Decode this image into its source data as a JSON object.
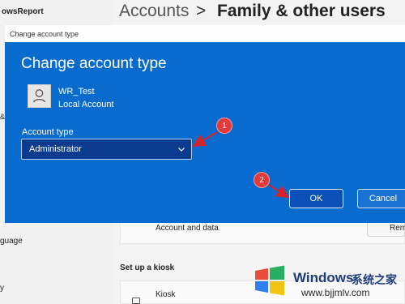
{
  "background": {
    "sidebar_app_name": "owsReport",
    "sidebar_item_partial": "&",
    "sidebar_item_language": "guage",
    "sidebar_item_y": "y",
    "breadcrumb_parent": "Accounts",
    "breadcrumb_separator": ">",
    "breadcrumb_current": "Family & other users",
    "account_row_label": "Account and data",
    "remove_button_partial": "Rem",
    "kiosk_section_title": "Set up a kiosk",
    "kiosk_row_label": "Kiosk"
  },
  "dialog": {
    "title": "Change account type",
    "heading": "Change account type",
    "user_name": "WR_Test",
    "user_type": "Local Account",
    "account_type_label": "Account type",
    "account_type_value": "Administrator",
    "ok_label": "OK",
    "cancel_label": "Cancel"
  },
  "annotations": {
    "marker_1": "1",
    "marker_2": "2"
  },
  "watermark": {
    "brand": "Windows",
    "brand_cn": "系统之家",
    "url": "www.bjjmlv.com"
  },
  "colors": {
    "dialog_blue": "#0a6bcf",
    "select_bg": "#0b3b8f",
    "marker_red": "#e23a3a",
    "arrow_red": "#d2232a"
  }
}
